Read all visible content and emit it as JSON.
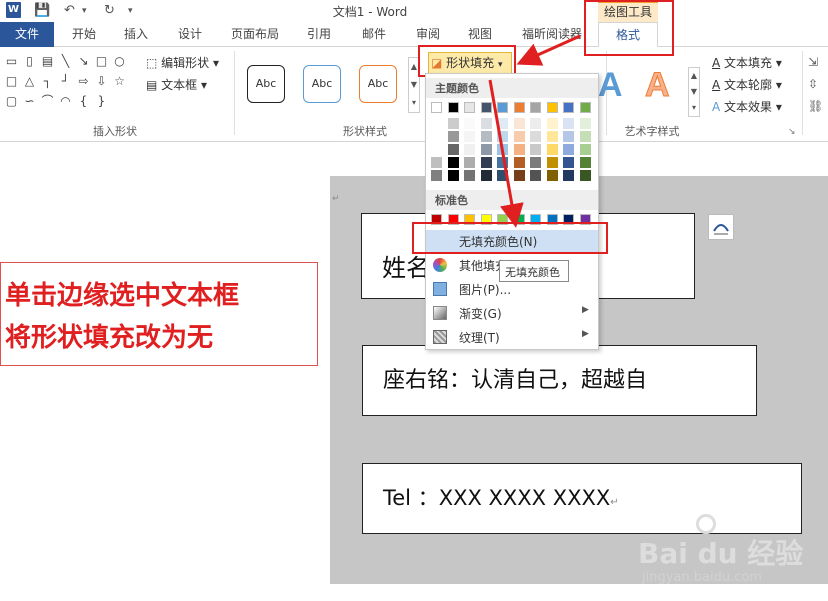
{
  "window": {
    "title": "文档1 - Word",
    "logo_letter": "W"
  },
  "quick_access": {
    "save": "💾",
    "undo": "↶",
    "redo": "↻",
    "more": "▾"
  },
  "context_group": "绘图工具",
  "tabs": [
    "开始",
    "插入",
    "设计",
    "页面布局",
    "引用",
    "邮件",
    "审阅",
    "视图",
    "福昕阅读器"
  ],
  "file_tab": "文件",
  "format_tab": "格式",
  "ribbon": {
    "insert_shapes": {
      "label": "插入形状",
      "edit_shape": "编辑形状",
      "textbox": "文本框"
    },
    "shape_styles": {
      "label": "形状样式",
      "styles": [
        "Abc",
        "Abc",
        "Abc"
      ],
      "fill_button": "形状填充"
    },
    "wordart": {
      "label": "艺术字样式",
      "letters": [
        "A",
        "A"
      ],
      "text_fill": "文本填充",
      "text_outline": "文本轮廓",
      "text_effects": "文本效果"
    }
  },
  "dropdown": {
    "theme_header": "主题颜色",
    "standard_header": "标准色",
    "items": [
      {
        "label": "无填充颜色(N)",
        "icon": "no-fill-icon"
      },
      {
        "label": "其他填充颜色",
        "icon": "color-wheel-icon"
      },
      {
        "label": "图片(P)...",
        "icon": "picture-icon"
      },
      {
        "label": "渐变(G)",
        "icon": "gradient-icon"
      },
      {
        "label": "纹理(T)",
        "icon": "texture-icon"
      }
    ],
    "tooltip": "无填充颜色",
    "theme_top": [
      "#ffffff",
      "#000000",
      "#e7e6e6",
      "#44546a",
      "#5b9bd5",
      "#ed7d31",
      "#a5a5a5",
      "#ffc000",
      "#4472c4",
      "#70ad47"
    ],
    "standard": [
      "#c00000",
      "#ff0000",
      "#ffc000",
      "#ffff00",
      "#92d050",
      "#00b050",
      "#00b0f0",
      "#0070c0",
      "#002060",
      "#7030a0"
    ]
  },
  "document": {
    "name_line": "姓名",
    "motto_line": "座右铭：认清自己，超越自",
    "tel_line": "Tel  ：XXX XXXX XXXX"
  },
  "annotation": {
    "line1": "单击边缘选中文本框",
    "line2": "将形状填充改为无"
  },
  "watermark": {
    "brand": "Bai du 经验",
    "url": "jingyan.baidu.com"
  }
}
